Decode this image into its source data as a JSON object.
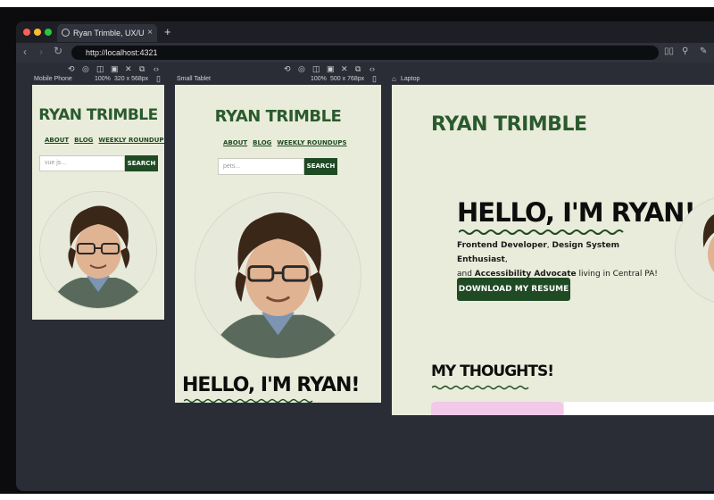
{
  "browser": {
    "tab_title": "Ryan Trimble, UX/UI Designer",
    "tab_close": "×",
    "new_tab": "+",
    "url": "http://localhost:4321",
    "nav": {
      "back": "‹",
      "forward": "›",
      "reload": "↻"
    },
    "traffic_colors": [
      "#ff5f57",
      "#febc2e",
      "#28c840"
    ]
  },
  "devices": [
    {
      "name": "Mobile Phone",
      "zoom": "100%",
      "size": "320 x 568px"
    },
    {
      "name": "Small Tablet",
      "zoom": "100%",
      "size": "500 x 768px"
    },
    {
      "name": "Laptop"
    }
  ],
  "site": {
    "title": "RYAN TRIMBLE",
    "nav": [
      "ABOUT",
      "BLOG",
      "WEEKLY ROUNDUPS"
    ],
    "search_mobile_placeholder": "vue js...",
    "search_tablet_placeholder": "pets...",
    "search_button": "SEARCH",
    "hello": "HELLO, I'M RYAN!",
    "intro_line1_a": "Frontend Developer",
    "intro_line1_b": ", ",
    "intro_line1_c": "Design System Enthusiast",
    "intro_line1_d": ",",
    "intro_line2_a": "and ",
    "intro_line2_b": "Accessibility Advocate",
    "intro_line2_c": " living in Central PA!",
    "resume_button": "DOWNLOAD MY RESUME",
    "thoughts_heading": "MY THOUGHTS!",
    "colors": {
      "background": "#e9ecda",
      "brand_green": "#1f4a24",
      "card_pink": "#f2c9e8"
    }
  }
}
